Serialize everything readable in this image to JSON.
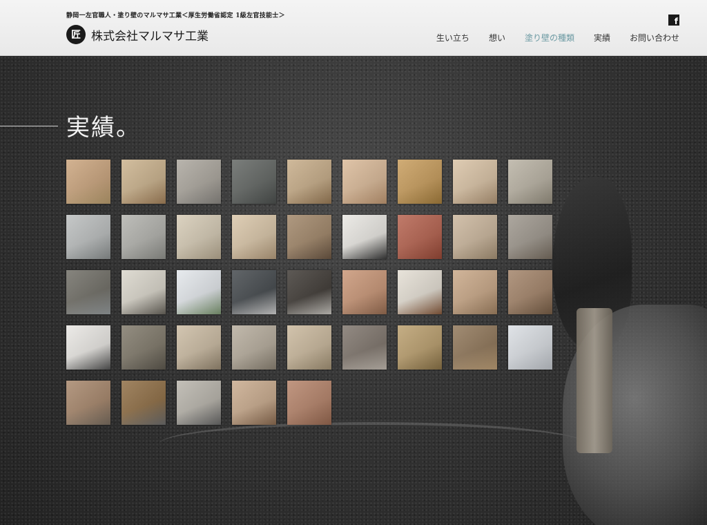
{
  "header": {
    "tagline": "静岡一左官職人・塗り壁のマルマサ工業＜厚生労働省認定 1級左官技能士＞",
    "logo_mark": "匠",
    "company_name": "株式会社マルマサ工業",
    "facebook_glyph": "f",
    "icons": {
      "facebook": "facebook-icon",
      "logo": "company-logo-icon"
    }
  },
  "nav": [
    {
      "label": "生い立ち",
      "active": false
    },
    {
      "label": "想い",
      "active": false
    },
    {
      "label": "塗り壁の種類",
      "active": true
    },
    {
      "label": "実績",
      "active": false
    },
    {
      "label": "お問い合わせ",
      "active": false
    }
  ],
  "colors": {
    "nav_active": "#6c9aa3",
    "header_bg": "#efefef",
    "page_bg": "#2b2b2b"
  },
  "main": {
    "section_title": "実績。",
    "thumbnails": [
      [
        "#c9a27a",
        "#bca070"
      ],
      [
        "#c9b08a",
        "#a6835c"
      ],
      [
        "#a9a49b",
        "#8d8a85"
      ],
      [
        "#5e625f",
        "#4e5250"
      ],
      [
        "#c5aa85",
        "#9c7d58"
      ],
      [
        "#d9b896",
        "#c49b75"
      ],
      [
        "#c69a58",
        "#a8803e"
      ],
      [
        "#d8c1a3",
        "#b69a7a"
      ],
      [
        "#b7b0a1",
        "#9a9383"
      ],
      [
        "#b9bcbc",
        "#8f9494"
      ],
      [
        "#b0b0ab",
        "#93948f"
      ],
      [
        "#d4c9b3",
        "#bcae95"
      ],
      [
        "#d8c4a6",
        "#b9a080"
      ],
      [
        "#9e8365",
        "#6d5845"
      ],
      [
        "#e8e6e1",
        "#3a3a3a"
      ],
      [
        "#b35e4a",
        "#9b4b39"
      ],
      [
        "#c9b49a",
        "#a99478"
      ],
      [
        "#9b948a",
        "#7a6f62"
      ],
      [
        "#6c6a62",
        "#9aa0a2"
      ],
      [
        "#d8d4c9",
        "#6b675e"
      ],
      [
        "#e2e6ea",
        "#7f9b74"
      ],
      [
        "#3f4448",
        "#d9d9d9"
      ],
      [
        "#3a3530",
        "#d2cfc9"
      ],
      [
        "#c79373",
        "#9b6f54"
      ],
      [
        "#e3ddd2",
        "#8a5b3c"
      ],
      [
        "#c7a584",
        "#a58565"
      ],
      [
        "#a08065",
        "#7a6048"
      ],
      [
        "#e8e6e2",
        "#555"
      ],
      [
        "#7c7566",
        "#5f5a50"
      ],
      [
        "#c9b9a0",
        "#9a8b74"
      ],
      [
        "#b4aa9a",
        "#8e8576"
      ],
      [
        "#c8b69a",
        "#a69578"
      ],
      [
        "#7b7168",
        "#c8c0b6"
      ],
      [
        "#b89c6a",
        "#8d7549"
      ],
      [
        "#8d7355",
        "#c2a37a"
      ],
      [
        "#d9dde2",
        "#c5cad0"
      ],
      [
        "#a48367",
        "#7b6f62"
      ],
      [
        "#8c6a40",
        "#6e6f70"
      ],
      [
        "#b6b2a9",
        "#6a6a6a"
      ],
      [
        "#c7a88a",
        "#8e6d52"
      ],
      [
        "#b38066",
        "#9a6a52"
      ]
    ]
  }
}
